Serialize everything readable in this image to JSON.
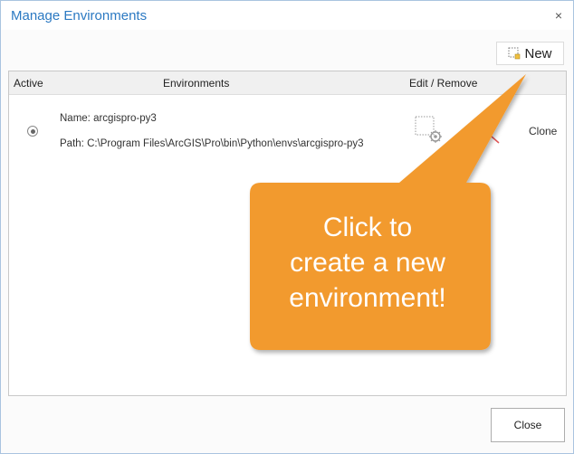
{
  "window": {
    "title": "Manage Environments",
    "close_glyph": "×"
  },
  "toolbar": {
    "new_label": "New",
    "new_icon": "new-environment-icon"
  },
  "table": {
    "headers": {
      "active": "Active",
      "environments": "Environments",
      "edit_remove": "Edit / Remove"
    },
    "rows": [
      {
        "active": true,
        "name_label": "Name:",
        "name": "arcgispro-py3",
        "path_label": "Path:",
        "path": "C:\\Program Files\\ArcGIS\\Pro\\bin\\Python\\envs\\arcgispro-py3",
        "edit_icon": "edit-environment-icon",
        "remove_icon": "remove-icon",
        "clone_label": "Clone"
      }
    ]
  },
  "footer": {
    "close_label": "Close"
  },
  "callout": {
    "lines": [
      "Click to",
      "create a new",
      "environment!"
    ],
    "color": "#f29a2e"
  },
  "colors": {
    "title": "#2b79c2",
    "callout": "#f29a2e",
    "remove": "#d44444"
  }
}
